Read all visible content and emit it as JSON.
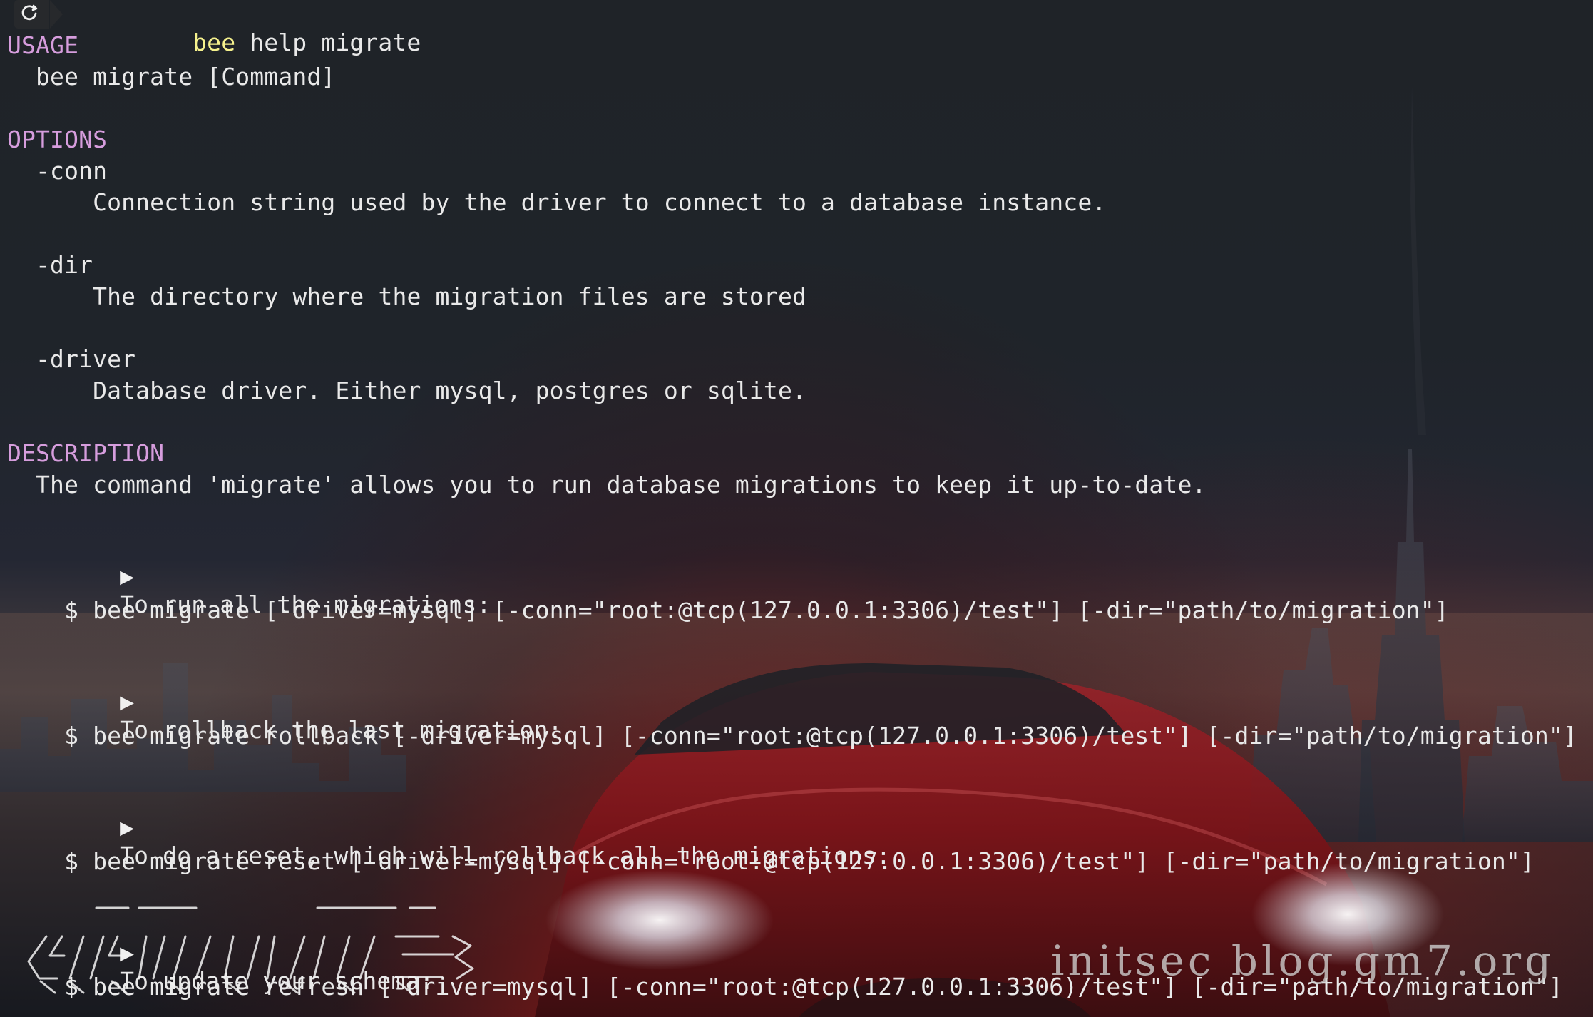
{
  "terminal": {
    "prompt": {
      "icon": "circular-arrow-icon",
      "command_bee": "bee",
      "command_rest": " help migrate"
    },
    "lines": [
      "USAGE",
      "  bee migrate [Command]",
      "",
      "OPTIONS",
      "  -conn",
      "      Connection string used by the driver to connect to a database instance.",
      "",
      "  -dir",
      "      The directory where the migration files are stored",
      "",
      "  -driver",
      "      Database driver. Either mysql, postgres or sqlite.",
      "",
      "DESCRIPTION",
      "  The command 'migrate' allows you to run database migrations to keep it up-to-date.",
      "",
      "To run all the migrations:",
      "",
      "    $ bee migrate [-driver=mysql] [-conn=\"root:@tcp(127.0.0.1:3306)/test\"] [-dir=\"path/to/migration\"]",
      "",
      "To rollback the last migration:",
      "",
      "    $ bee migrate rollback [-driver=mysql] [-conn=\"root:@tcp(127.0.0.1:3306)/test\"] [-dir=\"path/to/migration\"]",
      "",
      "To do a reset, which will rollback all the migrations:",
      "",
      "    $ bee migrate reset [-driver=mysql] [-conn=\"root:@tcp(127.0.0.1:3306)/test\"] [-dir=\"path/to/migration\"]",
      "",
      "To update your schema:",
      "",
      "    $ bee migrate refresh [-driver=mysql] [-conn=\"root:@tcp(127.0.0.1:3306)/test\"] [-dir=\"path/to/migration\"]"
    ],
    "bullet_icon": "triangle-right-icon",
    "bullet": "▶"
  },
  "watermark": {
    "text": "initsec blog.gm7.org"
  },
  "colors": {
    "heading": "#d69ddd",
    "command_accent": "#f5f18d",
    "text": "#e9e9e9"
  },
  "decoration": {
    "logo_icon": "ascii-logo-icon"
  }
}
